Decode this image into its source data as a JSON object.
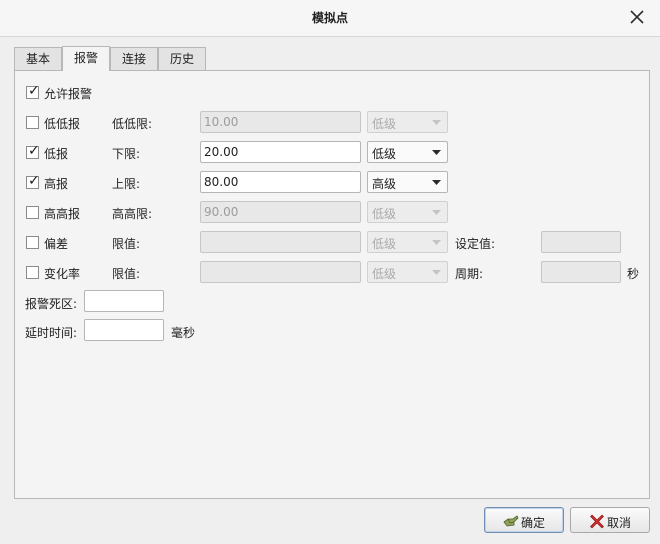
{
  "window": {
    "title": "模拟点"
  },
  "tabs": [
    {
      "label": "基本"
    },
    {
      "label": "报警"
    },
    {
      "label": "连接"
    },
    {
      "label": "历史"
    }
  ],
  "alarm": {
    "enable": {
      "label": "允许报警",
      "checked": true
    },
    "rows": {
      "lolo": {
        "label": "低低报",
        "checked": false,
        "limit_label": "低低限:",
        "value": "10.00",
        "level": "低级",
        "enabled": false
      },
      "lo": {
        "label": "低报",
        "checked": true,
        "limit_label": "下限:",
        "value": "20.00",
        "level": "低级",
        "enabled": true
      },
      "hi": {
        "label": "高报",
        "checked": true,
        "limit_label": "上限:",
        "value": "80.00",
        "level": "高级",
        "enabled": true
      },
      "hihi": {
        "label": "高高报",
        "checked": false,
        "limit_label": "高高限:",
        "value": "90.00",
        "level": "低级",
        "enabled": false
      },
      "dev": {
        "label": "偏差",
        "checked": false,
        "limit_label": "限值:",
        "value": "",
        "level": "低级",
        "enabled": false,
        "extra_label": "设定值:",
        "extra_value": ""
      },
      "roc": {
        "label": "变化率",
        "checked": false,
        "limit_label": "限值:",
        "value": "",
        "level": "低级",
        "enabled": false,
        "extra_label": "周期:",
        "extra_value": "",
        "unit": "秒"
      }
    },
    "deadband": {
      "label": "报警死区:",
      "value": ""
    },
    "delay": {
      "label": "延时时间:",
      "value": "",
      "unit": "毫秒"
    }
  },
  "buttons": {
    "ok": {
      "label": "确定",
      "icon": "checkmark-hand-icon"
    },
    "cancel": {
      "label": "取消",
      "icon": "red-x-icon"
    }
  }
}
